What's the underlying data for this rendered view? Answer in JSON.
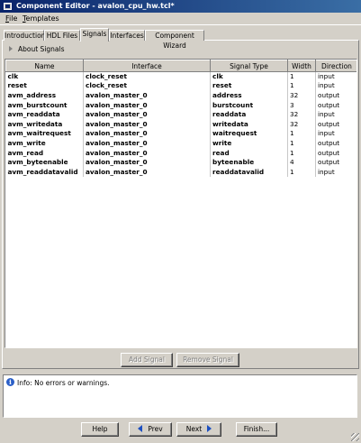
{
  "window": {
    "title": "Component Editor - avalon_cpu_hw.tcl*"
  },
  "menu": [
    {
      "label": "File",
      "key": "F",
      "rest": "ile"
    },
    {
      "label": "Templates",
      "key": "T",
      "rest": "emplates"
    }
  ],
  "tabs": [
    "Introduction",
    "HDL Files",
    "Signals",
    "Interfaces",
    "Component Wizard"
  ],
  "about": {
    "label": "About Signals"
  },
  "table": {
    "columns": [
      "Name",
      "Interface",
      "Signal Type",
      "Width",
      "Direction"
    ],
    "rows": [
      [
        "clk",
        "clock_reset",
        "clk",
        "1",
        "input"
      ],
      [
        "reset",
        "clock_reset",
        "reset",
        "1",
        "input"
      ],
      [
        "avm_address",
        "avalon_master_0",
        "address",
        "32",
        "output"
      ],
      [
        "avm_burstcount",
        "avalon_master_0",
        "burstcount",
        "3",
        "output"
      ],
      [
        "avm_readdata",
        "avalon_master_0",
        "readdata",
        "32",
        "input"
      ],
      [
        "avm_writedata",
        "avalon_master_0",
        "writedata",
        "32",
        "output"
      ],
      [
        "avm_waitrequest",
        "avalon_master_0",
        "waitrequest",
        "1",
        "input"
      ],
      [
        "avm_write",
        "avalon_master_0",
        "write",
        "1",
        "output"
      ],
      [
        "avm_read",
        "avalon_master_0",
        "read",
        "1",
        "output"
      ],
      [
        "avm_byteenable",
        "avalon_master_0",
        "byteenable",
        "4",
        "output"
      ],
      [
        "avm_readdatavalid",
        "avalon_master_0",
        "readdatavalid",
        "1",
        "input"
      ]
    ]
  },
  "buttons": {
    "add_signal": "Add Signal",
    "remove_signal": "Remove Signal",
    "help": "Help",
    "prev": "Prev",
    "next": "Next",
    "finish": "Finish..."
  },
  "info": {
    "message": "Info: No errors or warnings."
  }
}
